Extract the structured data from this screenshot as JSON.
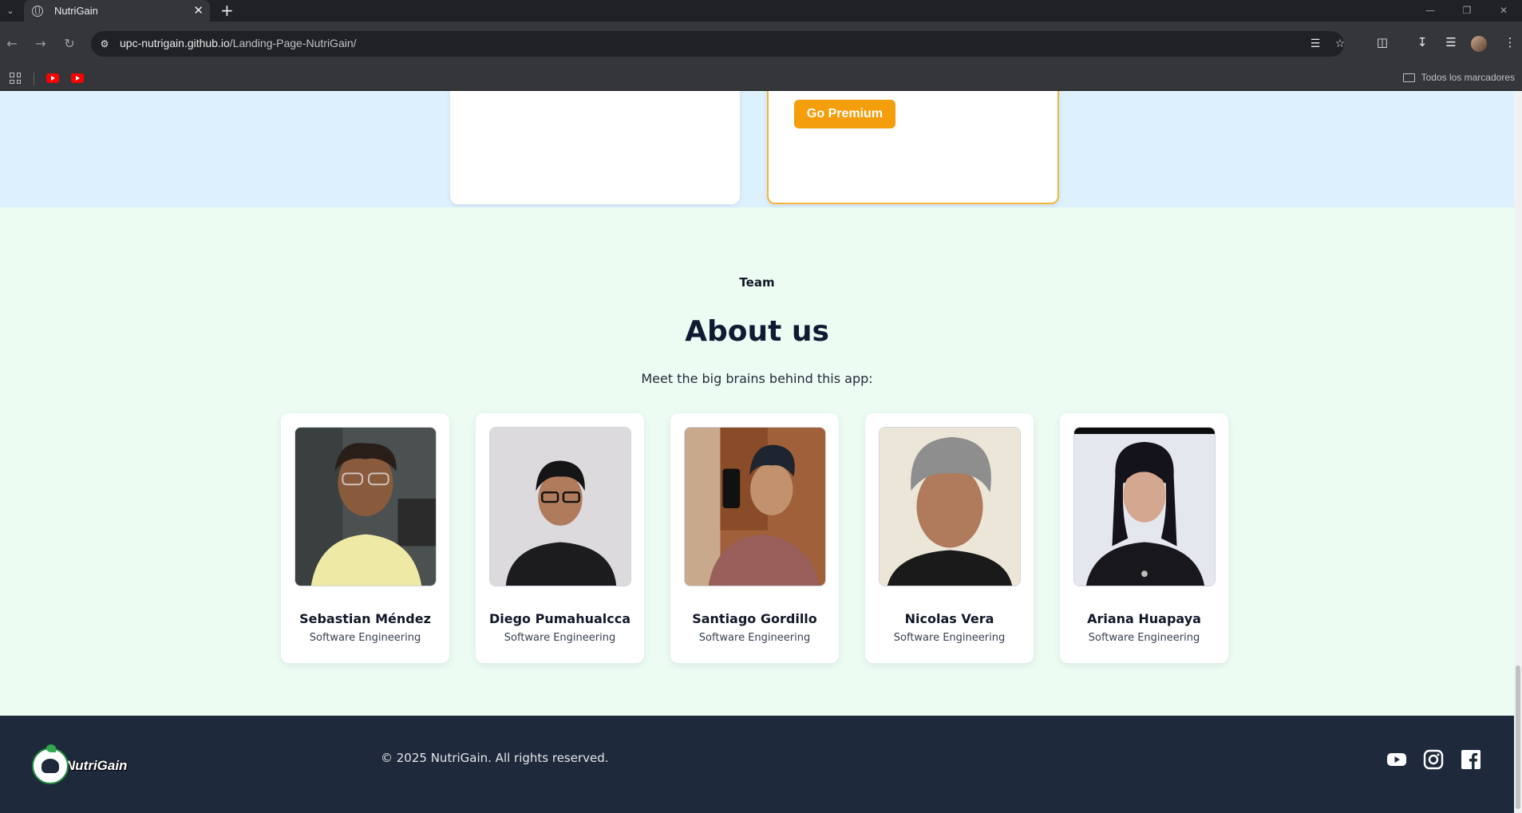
{
  "browser": {
    "tab_title": "NutriGain",
    "url_host": "upc-nutrigain.github.io",
    "url_path": "/Landing-Page-NutriGain/",
    "bookmarks_all": "Todos los marcadores"
  },
  "pricing": {
    "premium_button": "Go Premium"
  },
  "team": {
    "eyebrow": "Team",
    "title": "About us",
    "subtitle": "Meet the big brains behind this app:",
    "members": [
      {
        "name": "Sebastian Méndez",
        "role": "Software Engineering"
      },
      {
        "name": "Diego Pumahualcca",
        "role": "Software Engineering"
      },
      {
        "name": "Santiago Gordillo",
        "role": "Software Engineering"
      },
      {
        "name": "Nicolas Vera",
        "role": "Software Engineering"
      },
      {
        "name": "Ariana Huapaya",
        "role": "Software Engineering"
      }
    ]
  },
  "footer": {
    "logo_text": "NutriGain",
    "copyright": "© 2025 NutriGain. All rights reserved.",
    "social_icons": [
      "youtube-icon",
      "instagram-icon",
      "facebook-icon"
    ]
  },
  "colors": {
    "accent": "#f59e0b",
    "pricing_bg": "#ddf0fd",
    "team_bg": "#ecfcf3",
    "footer_bg": "#1e293b"
  }
}
